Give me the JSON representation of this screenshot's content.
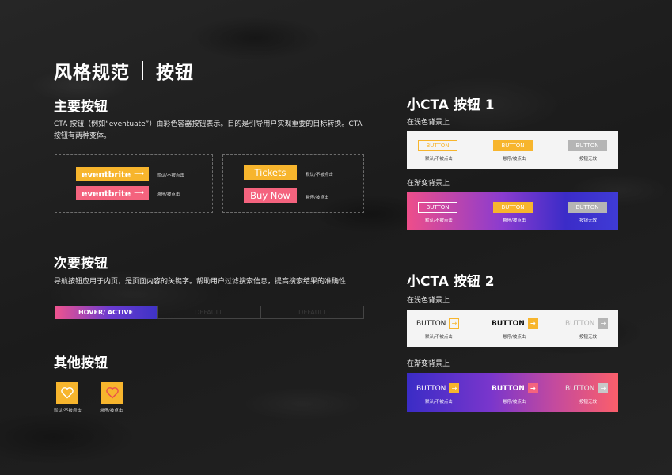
{
  "page": {
    "title_a": "风格规范",
    "title_b": "按钮"
  },
  "primary": {
    "heading": "主要按钮",
    "desc": "CTA 按钮（例如“eventuate”）由彩色容器按钮表示。目的是引导用户实现重要的目标转换。CTA 按钮有两种变体。",
    "eb_label": "eventbrite",
    "arrow": "⟶",
    "state_default": "默认/不被点击",
    "state_hover": "悬停/被点击",
    "tickets_label": "Tickets",
    "buynow_label": "Buy Now"
  },
  "secondary": {
    "heading": "次要按钮",
    "desc": "导航按钮应用于内页，是页面内容的关键字。帮助用户过滤搜索信息，提高搜索结果的准确性",
    "tabs": [
      "HOVER/ ACTIVE",
      "DEFAULT",
      "DEFAULT"
    ]
  },
  "other": {
    "heading": "其他按钮",
    "heart_icon": "heart-icon",
    "state_default": "默认/不被点击",
    "state_hover": "悬停/被点击"
  },
  "cta1": {
    "heading": "小CTA 按钮 1",
    "light_label": "在浅色背景上",
    "grad_label": "在渐变背景上",
    "button": "BUTTON",
    "cap_default": "默认/不被点击",
    "cap_hover": "悬停/被点击",
    "cap_disabled": "按钮无效"
  },
  "cta2": {
    "heading": "小CTA 按钮 2",
    "light_label": "在浅色背景上",
    "grad_label": "在渐变背景上",
    "button": "BUTTON",
    "arrow": "→",
    "cap_default": "默认/不被点击",
    "cap_hover": "悬停/被点击",
    "cap_disabled": "按钮无效"
  },
  "colors": {
    "accent_yellow": "#f7b52d",
    "accent_pink": "#f4637e",
    "disabled_gray": "#b5b5b5"
  }
}
